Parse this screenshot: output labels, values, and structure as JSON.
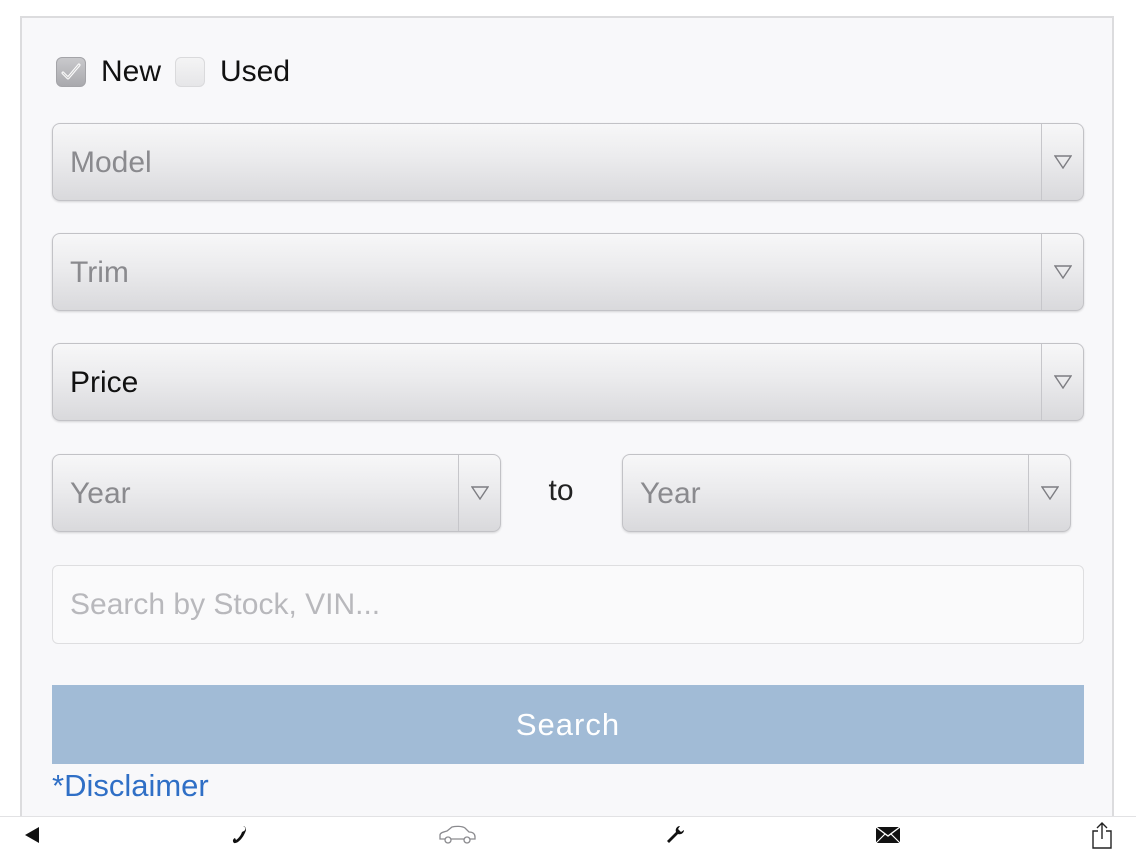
{
  "conditions": {
    "new": {
      "label": "New",
      "checked": true
    },
    "used": {
      "label": "Used",
      "checked": false
    }
  },
  "model_select": {
    "value": "Model"
  },
  "trim_select": {
    "value": "Trim"
  },
  "price_select": {
    "value": "Price"
  },
  "year_from_select": {
    "value": "Year"
  },
  "year_range_separator": "to",
  "year_to_select": {
    "value": "Year"
  },
  "search_input": {
    "placeholder": "Search by Stock, VIN...",
    "value": ""
  },
  "search_button": {
    "label": "Search"
  },
  "disclaimer_link": {
    "label": "*Disclaimer"
  },
  "bottom_toolbar": {
    "icons": [
      "back-arrow-icon",
      "phone-icon",
      "car-icon",
      "wrench-icon",
      "mail-icon",
      "share-icon"
    ]
  },
  "colors": {
    "button_bg": "#a1bbd6",
    "link": "#2f6fc6",
    "panel_bg": "#f8f8fa"
  }
}
